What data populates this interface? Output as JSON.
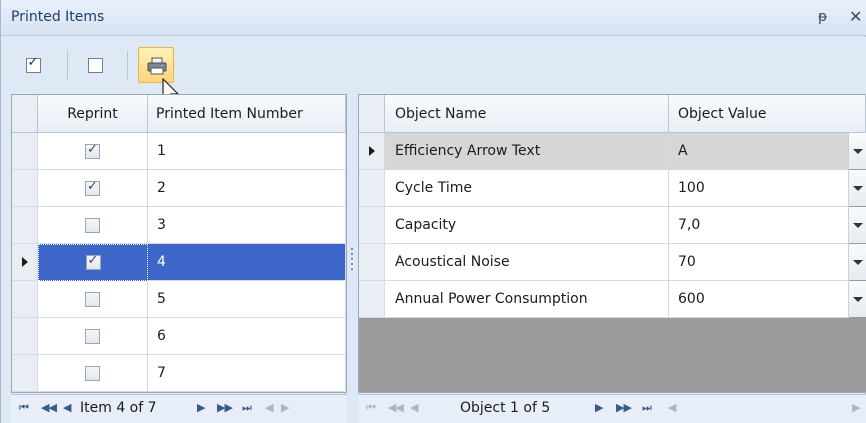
{
  "panel": {
    "title": "Printed Items",
    "pin_glyph": "ᵽ",
    "close_glyph": "✕"
  },
  "toolbar": {
    "icons": [
      "check-all-icon",
      "uncheck-all-icon",
      "print-icon"
    ]
  },
  "left_grid": {
    "columns": [
      "Reprint",
      "Printed Item Number"
    ],
    "rows": [
      {
        "reprint": true,
        "number": "1"
      },
      {
        "reprint": true,
        "number": "2"
      },
      {
        "reprint": false,
        "number": "3"
      },
      {
        "reprint": true,
        "number": "4"
      },
      {
        "reprint": false,
        "number": "5"
      },
      {
        "reprint": false,
        "number": "6"
      },
      {
        "reprint": false,
        "number": "7"
      }
    ],
    "selected_index": 3,
    "nav_text": "Item 4 of 7"
  },
  "right_grid": {
    "columns": [
      "Object Name",
      "Object Value"
    ],
    "rows": [
      {
        "name": "Efficiency Arrow Text",
        "value": "A"
      },
      {
        "name": "Cycle Time",
        "value": "100"
      },
      {
        "name": "Capacity",
        "value": "7,0"
      },
      {
        "name": "Acoustical Noise",
        "value": "70"
      },
      {
        "name": "Annual Power Consumption",
        "value": "600"
      }
    ],
    "selected_index": 0,
    "nav_text": "Object 1 of 5"
  },
  "colors": {
    "selection": "#3c67c9",
    "header_bg": "#e8eef6",
    "panel_bg": "#dfe9f5"
  }
}
